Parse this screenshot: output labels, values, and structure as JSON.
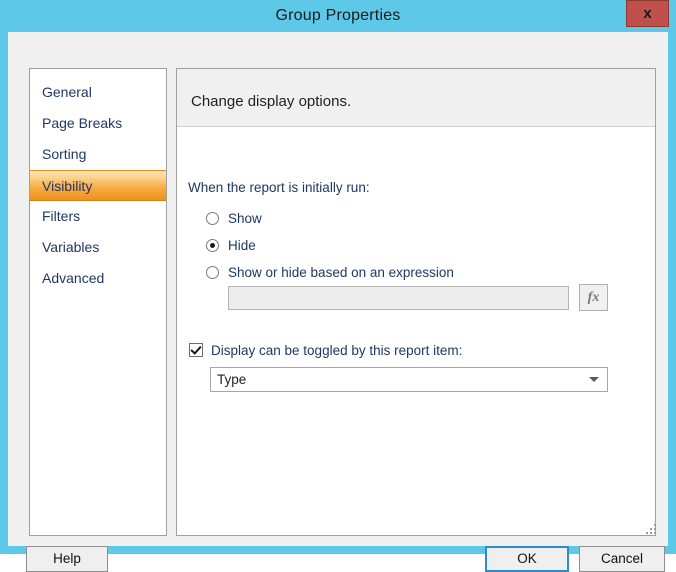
{
  "window": {
    "title": "Group Properties",
    "close_label": "x",
    "titlebar_color": "#5ec8e8",
    "close_button_color": "#c0504c"
  },
  "sidebar": {
    "items": [
      {
        "label": "General",
        "selected": false
      },
      {
        "label": "Page Breaks",
        "selected": false
      },
      {
        "label": "Sorting",
        "selected": false
      },
      {
        "label": "Visibility",
        "selected": true
      },
      {
        "label": "Filters",
        "selected": false
      },
      {
        "label": "Variables",
        "selected": false
      },
      {
        "label": "Advanced",
        "selected": false
      }
    ],
    "selected_accent": "#f0901c"
  },
  "panel": {
    "header_title": "Change display options.",
    "when_label": "When the report is initially run:",
    "radios": [
      {
        "label": "Show",
        "checked": false
      },
      {
        "label": "Hide",
        "checked": true
      },
      {
        "label": "Show or hide based on an expression",
        "checked": false
      }
    ],
    "expression": {
      "value": "",
      "placeholder": "",
      "enabled": false
    },
    "fx_button_label": "fx",
    "toggle": {
      "label": "Display can be toggled by this report item:",
      "checked": true
    },
    "report_item": {
      "value": "Type",
      "options": [
        "Type"
      ]
    }
  },
  "footer": {
    "help_label": "Help",
    "ok_label": "OK",
    "cancel_label": "Cancel"
  }
}
